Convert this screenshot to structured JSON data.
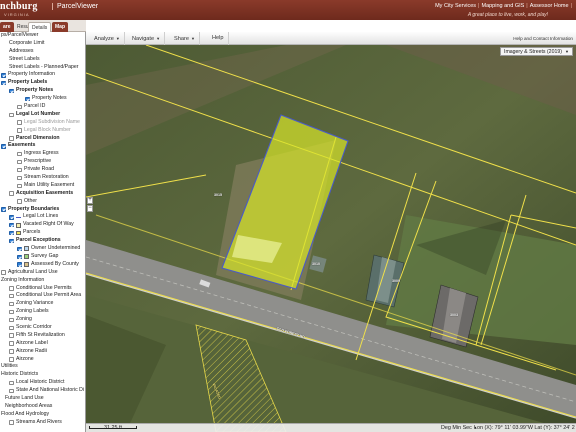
{
  "header": {
    "brand": "nchburg",
    "brand_sub": "VIRGINIA",
    "app_title": "ParcelViewer",
    "links": [
      "My City Services",
      "Mapping and GIS",
      "Assessor Home"
    ],
    "tagline": "A great place to live, work, and play!"
  },
  "left_tabs": [
    "are",
    "Results",
    "Details",
    "Map"
  ],
  "toolbar": {
    "items": [
      "Analyze",
      "Navigate",
      "Share",
      "Help"
    ],
    "help_link": "Help and Contact Information"
  },
  "basemap": "Imagery & Streets (2019)",
  "status": {
    "scale": "31.25 ft",
    "coord_mode": "Deg Min Sec",
    "coords": "Lon (X): 79° 11' 03.99\"W   Lat (Y): 37° 24' 2"
  },
  "map_labels": [
    "3010",
    "3009",
    "3003",
    "OLD FOREST RD",
    "VACATED",
    "3015"
  ],
  "layers": [
    {
      "label": "ps/ParcelViewer",
      "indent": 0,
      "checkbox": null,
      "style": "normal"
    },
    {
      "label": "Corporate Limit",
      "indent": 8,
      "checkbox": null,
      "style": "normal"
    },
    {
      "label": "Addresses",
      "indent": 8,
      "checkbox": null,
      "style": "normal"
    },
    {
      "label": "Street Labels",
      "indent": 8,
      "checkbox": null,
      "style": "normal"
    },
    {
      "label": "Street Labels - Planned/Paper",
      "indent": 8,
      "checkbox": null,
      "style": "normal"
    },
    {
      "label": "Property Information",
      "indent": 0,
      "checkbox": "on",
      "style": "normal"
    },
    {
      "label": "Property Labels",
      "indent": 0,
      "checkbox": "on",
      "style": "bold"
    },
    {
      "label": "Property Notes",
      "indent": 8,
      "checkbox": "on",
      "style": "bold"
    },
    {
      "label": "Property Notes",
      "indent": 24,
      "checkbox": "on",
      "style": "normal"
    },
    {
      "label": "Parcel ID",
      "indent": 16,
      "checkbox": "off",
      "style": "normal"
    },
    {
      "label": "Legal Lot Number",
      "indent": 8,
      "checkbox": "off",
      "style": "bold"
    },
    {
      "label": "Legal Subdivision Name",
      "indent": 16,
      "checkbox": "off",
      "style": "gray"
    },
    {
      "label": "Legal Block Number",
      "indent": 16,
      "checkbox": "off",
      "style": "gray"
    },
    {
      "label": "Parcel Dimension",
      "indent": 8,
      "checkbox": "off",
      "style": "bold"
    },
    {
      "label": "Easements",
      "indent": 0,
      "checkbox": "on",
      "style": "bold"
    },
    {
      "label": "Ingress Egress",
      "indent": 16,
      "checkbox": "off",
      "style": "normal"
    },
    {
      "label": "Prescriptive",
      "indent": 16,
      "checkbox": "off",
      "style": "normal"
    },
    {
      "label": "Private Road",
      "indent": 16,
      "checkbox": "off",
      "style": "normal"
    },
    {
      "label": "Stream Restoration",
      "indent": 16,
      "checkbox": "off",
      "style": "normal"
    },
    {
      "label": "Main Utility Easement",
      "indent": 16,
      "checkbox": "off",
      "style": "normal"
    },
    {
      "label": "Acquisition Easements",
      "indent": 8,
      "checkbox": "off",
      "style": "bold"
    },
    {
      "label": "Other",
      "indent": 16,
      "checkbox": "off",
      "style": "normal"
    },
    {
      "label": "Property Boundaries",
      "indent": 0,
      "checkbox": "on",
      "style": "bold"
    },
    {
      "label": "Legal Lot Lines",
      "indent": 8,
      "checkbox": "on",
      "style": "normal",
      "swatch": "line-blue"
    },
    {
      "label": "Vacated Right Of Way",
      "indent": 8,
      "checkbox": "on",
      "style": "normal",
      "swatch": "hatch"
    },
    {
      "label": "Parcels",
      "indent": 8,
      "checkbox": "on",
      "style": "normal",
      "swatch": "yellow"
    },
    {
      "label": "Parcel Exceptions",
      "indent": 8,
      "checkbox": "on",
      "style": "bold"
    },
    {
      "label": "Owner Undetermined",
      "indent": 16,
      "checkbox": "on",
      "style": "normal",
      "swatch": "lightblue"
    },
    {
      "label": "Survey Gap",
      "indent": 16,
      "checkbox": "on",
      "style": "normal",
      "swatch": "green"
    },
    {
      "label": "Assessed By County",
      "indent": 16,
      "checkbox": "on",
      "style": "normal",
      "swatch": "tan"
    },
    {
      "label": "Agricultural Land Use",
      "indent": 0,
      "checkbox": "off",
      "style": "normal"
    },
    {
      "label": "Zoning Information",
      "indent": 0,
      "checkbox": null,
      "style": "normal"
    },
    {
      "label": "Conditional Use Permits",
      "indent": 8,
      "checkbox": "off",
      "style": "normal"
    },
    {
      "label": "Conditional Use Permit Area",
      "indent": 8,
      "checkbox": "off",
      "style": "normal"
    },
    {
      "label": "Zoning Variance",
      "indent": 8,
      "checkbox": "off",
      "style": "normal"
    },
    {
      "label": "Zoning Labels",
      "indent": 8,
      "checkbox": "off",
      "style": "normal"
    },
    {
      "label": "Zoning",
      "indent": 8,
      "checkbox": "off",
      "style": "normal"
    },
    {
      "label": "Scenic Corridor",
      "indent": 8,
      "checkbox": "off",
      "style": "normal"
    },
    {
      "label": "Fifth St Revitalization",
      "indent": 8,
      "checkbox": "off",
      "style": "normal"
    },
    {
      "label": "Airzone Label",
      "indent": 8,
      "checkbox": "off",
      "style": "normal"
    },
    {
      "label": "Airzone Radii",
      "indent": 8,
      "checkbox": "off",
      "style": "normal"
    },
    {
      "label": "Airzone",
      "indent": 8,
      "checkbox": "off",
      "style": "normal"
    },
    {
      "label": "Utilities",
      "indent": 0,
      "checkbox": null,
      "style": "normal"
    },
    {
      "label": "Historic Districts",
      "indent": 0,
      "checkbox": null,
      "style": "normal"
    },
    {
      "label": "Local Historic District",
      "indent": 8,
      "checkbox": "off",
      "style": "normal"
    },
    {
      "label": "State And National Historic Di",
      "indent": 8,
      "checkbox": "off",
      "style": "normal"
    },
    {
      "label": "Future Land Use",
      "indent": 4,
      "checkbox": null,
      "style": "normal"
    },
    {
      "label": "Neighborhood Areas",
      "indent": 4,
      "checkbox": null,
      "style": "normal"
    },
    {
      "label": "Flood And Hydrology",
      "indent": 0,
      "checkbox": null,
      "style": "normal"
    },
    {
      "label": "Streams And Rivers",
      "indent": 8,
      "checkbox": "off",
      "style": "normal"
    }
  ],
  "colors": {
    "header": "#7a3324",
    "parcel_line": "#f0e04a",
    "selected_fill": "#d7e62a",
    "selected_outline": "#4a5bc6"
  }
}
